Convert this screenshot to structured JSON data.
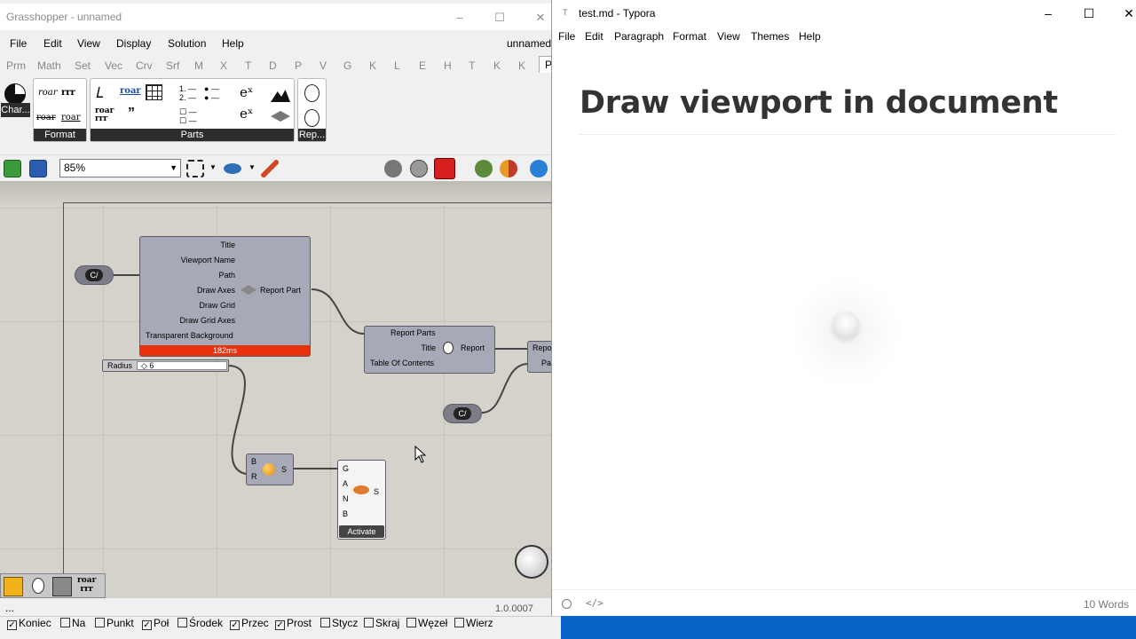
{
  "grasshopper": {
    "title": "Grasshopper - unnamed",
    "menu": [
      "File",
      "Edit",
      "View",
      "Display",
      "Solution",
      "Help"
    ],
    "doc_name": "unnamed",
    "tabs": [
      "Prm",
      "Math",
      "Set",
      "Vec",
      "Crv",
      "Srf",
      "M",
      "X",
      "T",
      "D",
      "P",
      "V",
      "G",
      "K",
      "L",
      "E",
      "H",
      "T",
      "K",
      "K",
      "P"
    ],
    "ribbon": {
      "chart_label": "Char...",
      "format_label": "Format",
      "parts_label": "Parts",
      "rep_label": "Rep...",
      "roar_1": "roar",
      "rrr_1": "rrr",
      "roar_2": "roar",
      "roar_3": "roar",
      "roar_4": "roar",
      "roar_5": "roar",
      "rrr_2": "rrr",
      "quote": "”",
      "list_123": "1.…2.",
      "exp_1": "eˣ",
      "exp_2": "eˣ"
    },
    "zoom": "85%",
    "canvas": {
      "main_component": {
        "inputs": [
          "Title",
          "Viewport Name",
          "Path",
          "Draw Axes",
          "Draw Grid",
          "Draw Grid Axes",
          "Transparent Background"
        ],
        "output": "Report Part",
        "timing": "182ms"
      },
      "slider": {
        "label": "Radius",
        "value": "◇ 6"
      },
      "report_component": {
        "header": "Report Parts",
        "inputs": [
          "Title",
          "Table Of Contents"
        ],
        "output": "Report"
      },
      "partial_component": {
        "rows": [
          "Repo",
          "Pat"
        ]
      },
      "sphere_component": {
        "inputs": [
          "B",
          "R"
        ],
        "output": "S"
      },
      "preview_component": {
        "inputs": [
          "G",
          "A",
          "N",
          "B"
        ],
        "output": "S",
        "button": "Activate"
      },
      "panel_small_label": "C/"
    },
    "bottom_tools": {
      "roar": "roar",
      "rrr": "rrr"
    },
    "status_left": "...",
    "version": "1.0.0007",
    "osnaps": [
      {
        "label": "Koniec",
        "checked": true
      },
      {
        "label": "Na",
        "checked": false
      },
      {
        "label": "Punkt",
        "checked": false
      },
      {
        "label": "Poł",
        "checked": true
      },
      {
        "label": "Środek",
        "checked": false
      },
      {
        "label": "Przec",
        "checked": true
      },
      {
        "label": "Prost",
        "checked": true
      },
      {
        "label": "Stycz",
        "checked": false
      },
      {
        "label": "Skraj",
        "checked": false
      },
      {
        "label": "Węzeł",
        "checked": false
      },
      {
        "label": "Wierz",
        "checked": false
      }
    ]
  },
  "typora": {
    "title": "test.md - Typora",
    "logo": "T",
    "menu": [
      "File",
      "Edit",
      "Paragraph",
      "Format",
      "View",
      "Themes",
      "Help"
    ],
    "heading": "Draw viewport in document",
    "word_count": "10 Words"
  },
  "colors": {
    "timing_bar": "#e8320e",
    "component": "#a8a9b6",
    "desktop": "#0a63c9"
  }
}
